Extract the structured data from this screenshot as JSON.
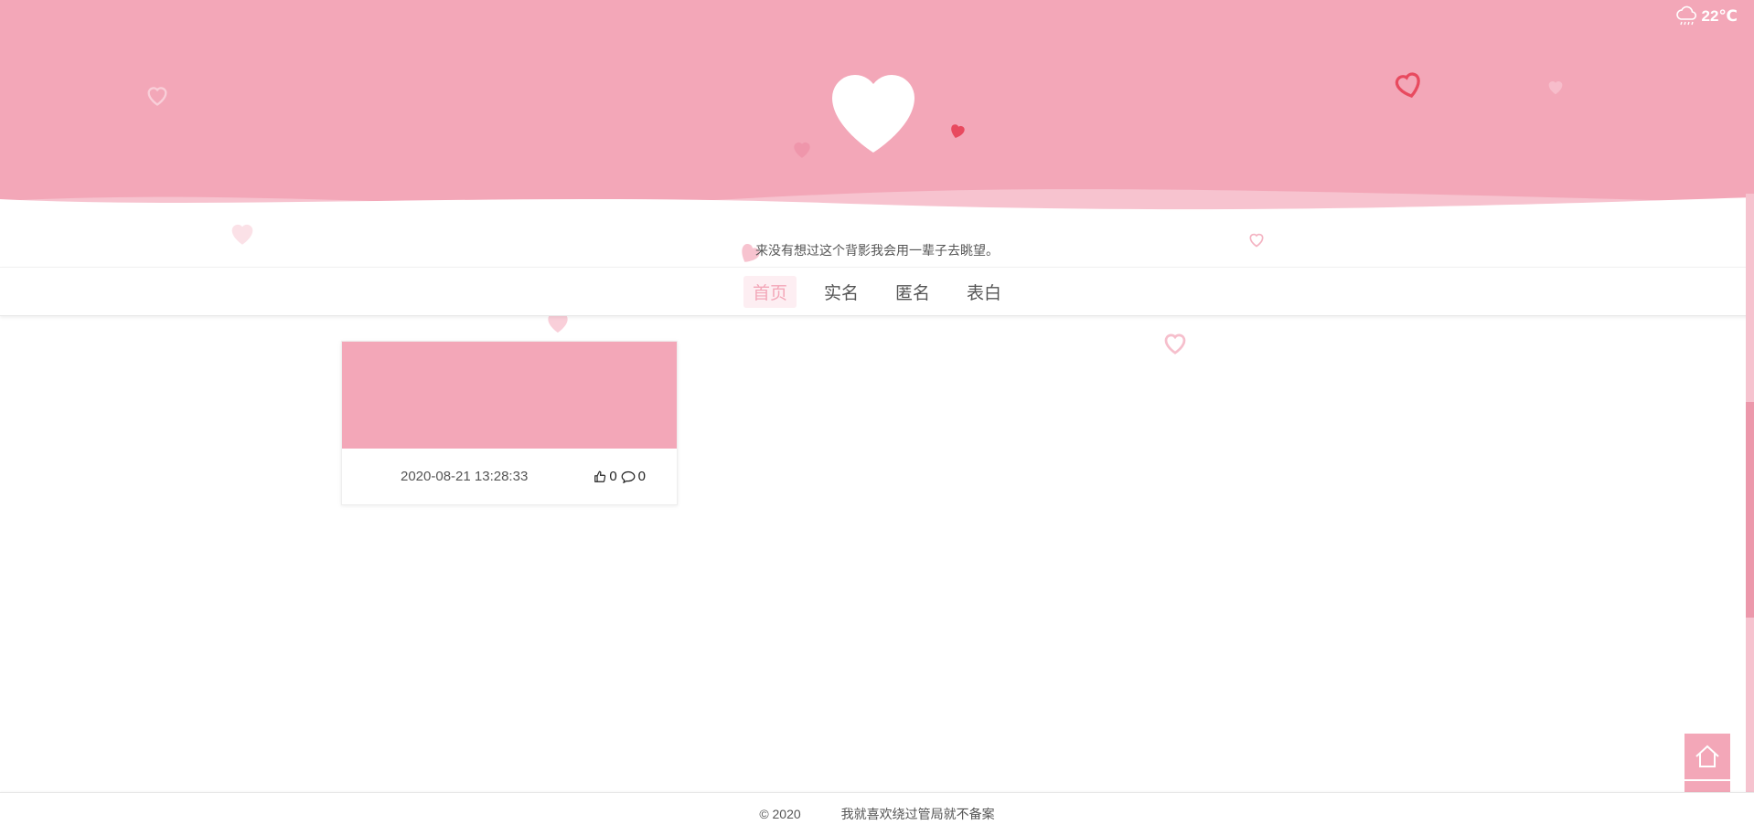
{
  "weather": {
    "icon": "rain-cloud-icon",
    "temperature": "22℃"
  },
  "header": {
    "logo_icon": "heart-icon",
    "background": "#f3a7b8"
  },
  "tagline": "来没有想过这个背影我会用一辈子去眺望。",
  "nav": {
    "items": [
      {
        "label": "首页",
        "active": true
      },
      {
        "label": "实名",
        "active": false
      },
      {
        "label": "匿名",
        "active": false
      },
      {
        "label": "表白",
        "active": false
      }
    ]
  },
  "posts": [
    {
      "date": "2020-08-21 13:28:33",
      "likes": "0",
      "comments": "0",
      "like_icon": "thumbs-up-icon",
      "comment_icon": "comment-icon"
    }
  ],
  "footer": {
    "copyright": "© 2020",
    "text": "我就喜欢绕过管局就不备案"
  },
  "float_buttons": {
    "home_icon": "home-icon",
    "search_icon": "search-icon"
  },
  "colors": {
    "accent": "#f3a7b8",
    "accent_light": "#fdeef2",
    "heart_red": "#e84a5f"
  }
}
